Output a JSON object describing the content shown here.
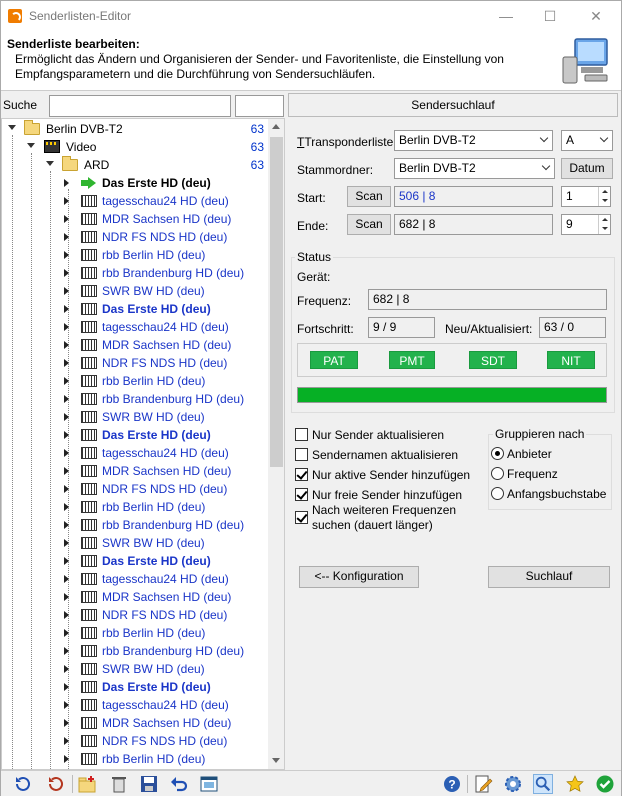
{
  "window": {
    "title": "Senderlisten-Editor"
  },
  "header": {
    "title": "Senderliste bearbeiten:",
    "description": "Ermöglicht das Ändern und Organisieren der Sender- und Favoritenliste, die Einstellung von Empfangsparametern und die Durchführung von Sendersuchläufen."
  },
  "search": {
    "label": "Suche",
    "value": ""
  },
  "tree": {
    "root": {
      "label": "Berlin DVB-T2",
      "count": "63"
    },
    "video": {
      "label": "Video",
      "count": "63"
    },
    "ard": {
      "label": "ARD",
      "count": "63"
    },
    "channels": [
      "Das Erste HD (deu)",
      "tagesschau24 HD (deu)",
      "MDR Sachsen HD (deu)",
      "NDR FS NDS HD (deu)",
      "rbb Berlin HD (deu)",
      "rbb Brandenburg HD (deu)",
      "SWR BW HD (deu)",
      "Das Erste HD (deu)",
      "tagesschau24 HD (deu)",
      "MDR Sachsen HD (deu)",
      "NDR FS NDS HD (deu)",
      "rbb Berlin HD (deu)",
      "rbb Brandenburg HD (deu)",
      "SWR BW HD (deu)",
      "Das Erste HD (deu)",
      "tagesschau24 HD (deu)",
      "MDR Sachsen HD (deu)",
      "NDR FS NDS HD (deu)",
      "rbb Berlin HD (deu)",
      "rbb Brandenburg HD (deu)",
      "SWR BW HD (deu)",
      "Das Erste HD (deu)",
      "tagesschau24 HD (deu)",
      "MDR Sachsen HD (deu)",
      "NDR FS NDS HD (deu)",
      "rbb Berlin HD (deu)",
      "rbb Brandenburg HD (deu)",
      "SWR BW HD (deu)",
      "Das Erste HD (deu)",
      "tagesschau24 HD (deu)",
      "MDR Sachsen HD (deu)",
      "NDR FS NDS HD (deu)",
      "rbb Berlin HD (deu)"
    ]
  },
  "scan": {
    "panel_title": "Sendersuchlauf",
    "transponder_label": "Transponderliste:",
    "transponder_value": "Berlin DVB-T2",
    "transponder_option": "A",
    "root_label": "Stammordner:",
    "root_value": "Berlin DVB-T2",
    "date_button": "Datum",
    "start_label": "Start:",
    "start_scan": "Scan",
    "start_value": "506 | 8",
    "start_spin": "1",
    "end_label": "Ende:",
    "end_scan": "Scan",
    "end_value": "682 | 8",
    "end_spin": "9"
  },
  "status": {
    "title": "Status",
    "device_label": "Gerät:",
    "frequency_label": "Frequenz:",
    "frequency_value": "682 | 8",
    "progress_label": "Fortschritt:",
    "progress_value": "9 / 9",
    "new_label": "Neu/Aktualisiert:",
    "new_value": "63 / 0",
    "tags": [
      "PAT",
      "PMT",
      "SDT",
      "NIT"
    ],
    "progress_fraction": 1.0
  },
  "options": {
    "only_update": {
      "label": "Nur Sender aktualisieren",
      "checked": false
    },
    "update_names": {
      "label": "Sendernamen aktualisieren",
      "checked": false
    },
    "only_active": {
      "label": "Nur aktive Sender hinzufügen",
      "checked": true
    },
    "only_free": {
      "label": "Nur freie Sender hinzufügen",
      "checked": true
    },
    "more_freq_1": "Nach weiteren Frequenzen",
    "more_freq_2": "suchen (dauert länger)",
    "more_freq_checked": true
  },
  "group": {
    "title": "Gruppieren nach",
    "provider": "Anbieter",
    "frequency": "Frequenz",
    "initial": "Anfangsbuchstabe",
    "selected": "provider"
  },
  "buttons": {
    "config": "<-- Konfiguration",
    "search": "Suchlauf"
  }
}
